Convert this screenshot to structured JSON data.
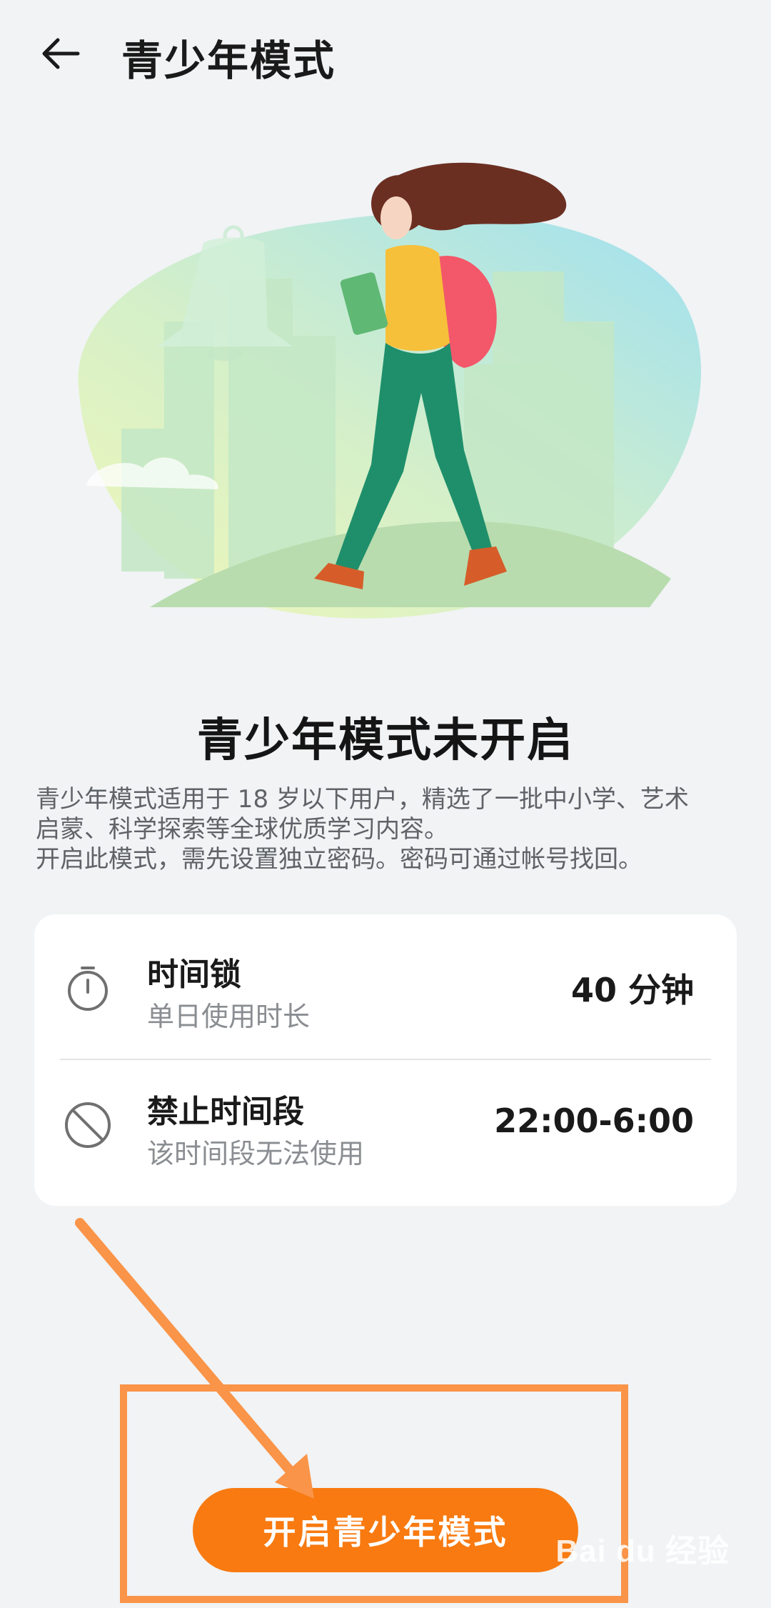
{
  "header": {
    "title": "青少年模式",
    "back_icon": "arrow-left-icon"
  },
  "status": {
    "title": "青少年模式未开启"
  },
  "description": {
    "line1": "青少年模式适用于 18 岁以下用户，精选了一批中小学、艺术",
    "line2": "启蒙、科学探索等全球优质学习内容。",
    "line3": "开启此模式，需先设置独立密码。密码可通过帐号找回。"
  },
  "settings": {
    "time_lock": {
      "icon": "timer-icon",
      "title": "时间锁",
      "subtitle": "单日使用时长",
      "value": "40 分钟"
    },
    "forbidden_period": {
      "icon": "forbidden-icon",
      "title": "禁止时间段",
      "subtitle": "该时间段无法使用",
      "value": "22:00-6:00"
    }
  },
  "cta": {
    "label": "开启青少年模式"
  },
  "watermark": {
    "text": "Bai du 经验"
  },
  "colors": {
    "background": "#f1f3f5",
    "accent": "#f87a10",
    "annotation": "#f99448",
    "card": "#ffffff"
  }
}
